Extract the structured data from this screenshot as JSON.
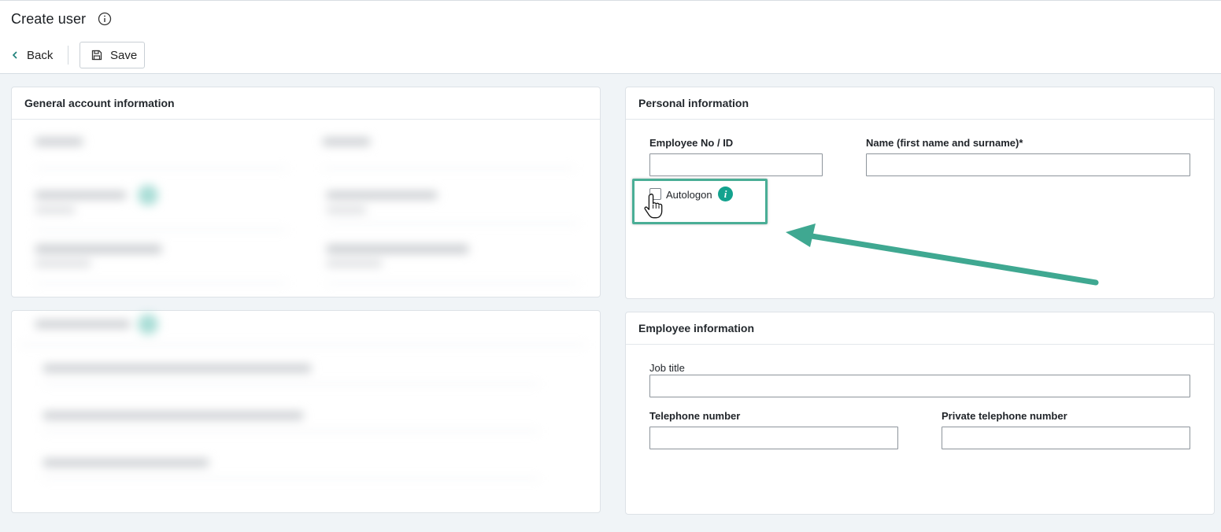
{
  "header": {
    "title": "Create user",
    "back_label": "Back",
    "save_label": "Save"
  },
  "cards": {
    "general": {
      "title": "General account information"
    },
    "personal": {
      "title": "Personal information",
      "employee_no_label": "Employee No / ID",
      "employee_no_value": "",
      "name_label": "Name (first name and surname)*",
      "name_value": "",
      "autologon_label": "Autologon",
      "autologon_checked": false,
      "info_glyph": "i"
    },
    "employee": {
      "title": "Employee information",
      "job_title_label": "Job title",
      "job_title_value": "",
      "telephone_label": "Telephone number",
      "telephone_value": "",
      "private_telephone_label": "Private telephone number",
      "private_telephone_value": ""
    }
  },
  "icons": {
    "title_info": "info-circle-icon",
    "back": "chevron-left-icon",
    "save": "floppy-disk-icon",
    "autologon_info": "info-icon",
    "cursor": "hand-pointer-icon",
    "annotation": "arrow-annotation"
  },
  "colors": {
    "accent": "#13a28e",
    "highlight": "#4aae96",
    "background": "#f0f4f7"
  }
}
